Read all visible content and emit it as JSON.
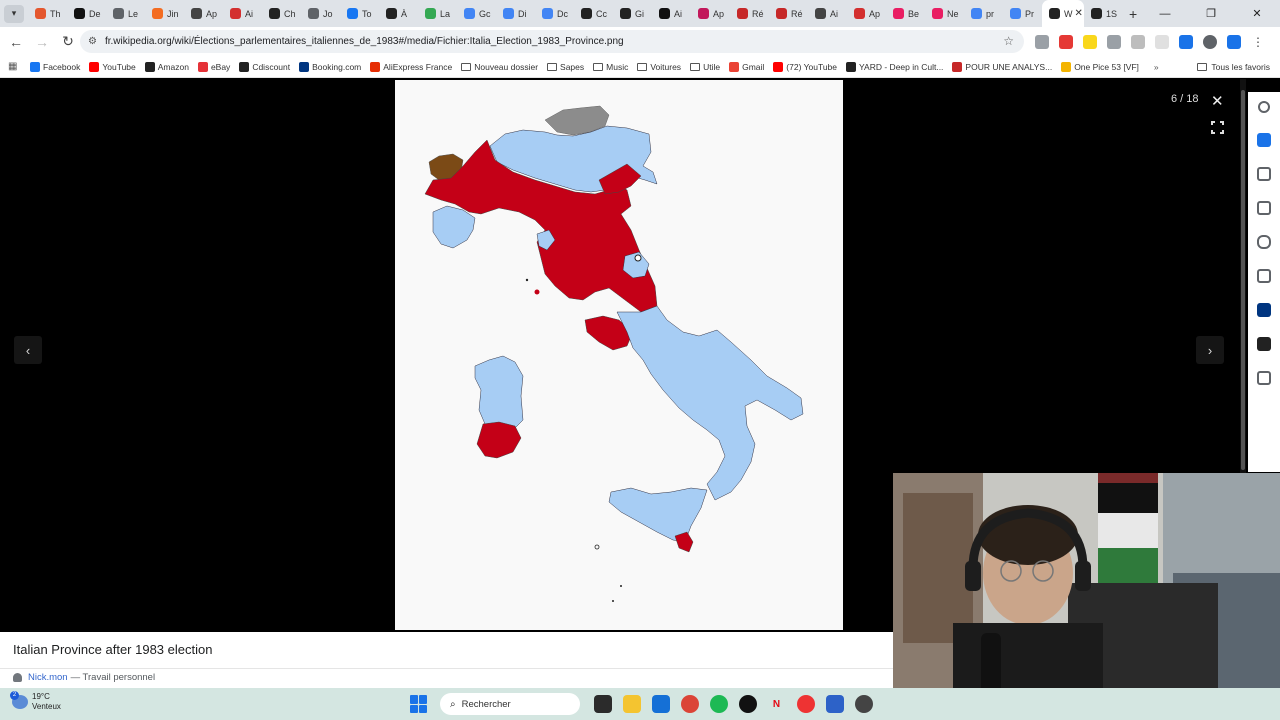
{
  "browser": {
    "tabs": [
      {
        "label": "Th",
        "color": "#e4572e"
      },
      {
        "label": "De",
        "color": "#111111"
      },
      {
        "label": "Le",
        "color": "#5f6368"
      },
      {
        "label": "Jin",
        "color": "#f36c21"
      },
      {
        "label": "Ap",
        "color": "#444444"
      },
      {
        "label": "Ai",
        "color": "#d32f2f"
      },
      {
        "label": "Ch",
        "color": "#222222"
      },
      {
        "label": "Jo",
        "color": "#5f6368"
      },
      {
        "label": "To",
        "color": "#1877f2"
      },
      {
        "label": "À",
        "color": "#222222"
      },
      {
        "label": "La",
        "color": "#34a853"
      },
      {
        "label": "Gc",
        "color": "#4285f4"
      },
      {
        "label": "Di",
        "color": "#4285f4"
      },
      {
        "label": "Dc",
        "color": "#4285f4"
      },
      {
        "label": "Cc",
        "color": "#222222"
      },
      {
        "label": "Gi",
        "color": "#222222"
      },
      {
        "label": "Ai",
        "color": "#111111"
      },
      {
        "label": "Ap",
        "color": "#c2185b"
      },
      {
        "label": "Ré",
        "color": "#c62828"
      },
      {
        "label": "Ré",
        "color": "#c62828"
      },
      {
        "label": "Ai",
        "color": "#444444"
      },
      {
        "label": "Ap",
        "color": "#d32f2f"
      },
      {
        "label": "Be",
        "color": "#e91e63"
      },
      {
        "label": "Ne",
        "color": "#e91e63"
      },
      {
        "label": "pr",
        "color": "#4285f4"
      },
      {
        "label": "Pr",
        "color": "#4285f4"
      },
      {
        "label": "W",
        "color": "#222222",
        "active": true
      },
      {
        "label": "1S",
        "color": "#222222"
      }
    ],
    "url": "fr.wikipedia.org/wiki/Élections_parlementaires_italiennes_de_1983#/media/Fichier:Italia_Election_1983_Province.png",
    "bookmarks": [
      {
        "label": "Facebook",
        "type": "site",
        "color": "#1877f2"
      },
      {
        "label": "YouTube",
        "type": "site",
        "color": "#ff0000"
      },
      {
        "label": "Amazon",
        "type": "site",
        "color": "#222222"
      },
      {
        "label": "eBay",
        "type": "site",
        "color": "#e53238"
      },
      {
        "label": "Cdiscount",
        "type": "site",
        "color": "#222222"
      },
      {
        "label": "Booking.com",
        "type": "site",
        "color": "#003580"
      },
      {
        "label": "AliExpress France",
        "type": "site",
        "color": "#e62e04"
      },
      {
        "label": "Nouveau dossier",
        "type": "folder"
      },
      {
        "label": "Sapes",
        "type": "folder"
      },
      {
        "label": "Music",
        "type": "folder"
      },
      {
        "label": "Voitures",
        "type": "folder"
      },
      {
        "label": "Utile",
        "type": "folder"
      },
      {
        "label": "Gmail",
        "type": "site",
        "color": "#ea4335"
      },
      {
        "label": "(72) YouTube",
        "type": "site",
        "color": "#ff0000"
      },
      {
        "label": "YARD - Deep in Cult...",
        "type": "site",
        "color": "#222222"
      },
      {
        "label": "POUR UNE ANALYS...",
        "type": "site",
        "color": "#c62828"
      },
      {
        "label": "One Pice 53 [VF]",
        "type": "site",
        "color": "#f4b400"
      }
    ],
    "all_bookmarks_label": "Tous les favoris"
  },
  "viewer": {
    "counter": "6 / 18",
    "caption_title": "Italian Province after 1983 election",
    "author": "Nick.mon",
    "author_suffix": "— Travail personnel",
    "map_colors": {
      "blue": "#a7cdf4",
      "red": "#c40017",
      "gray": "#8c8c8c",
      "brown": "#7b4a16"
    }
  },
  "taskbar": {
    "temperature": "19°C",
    "weather_text": "Venteux",
    "weather_badge": "2",
    "search_placeholder": "Rechercher"
  }
}
